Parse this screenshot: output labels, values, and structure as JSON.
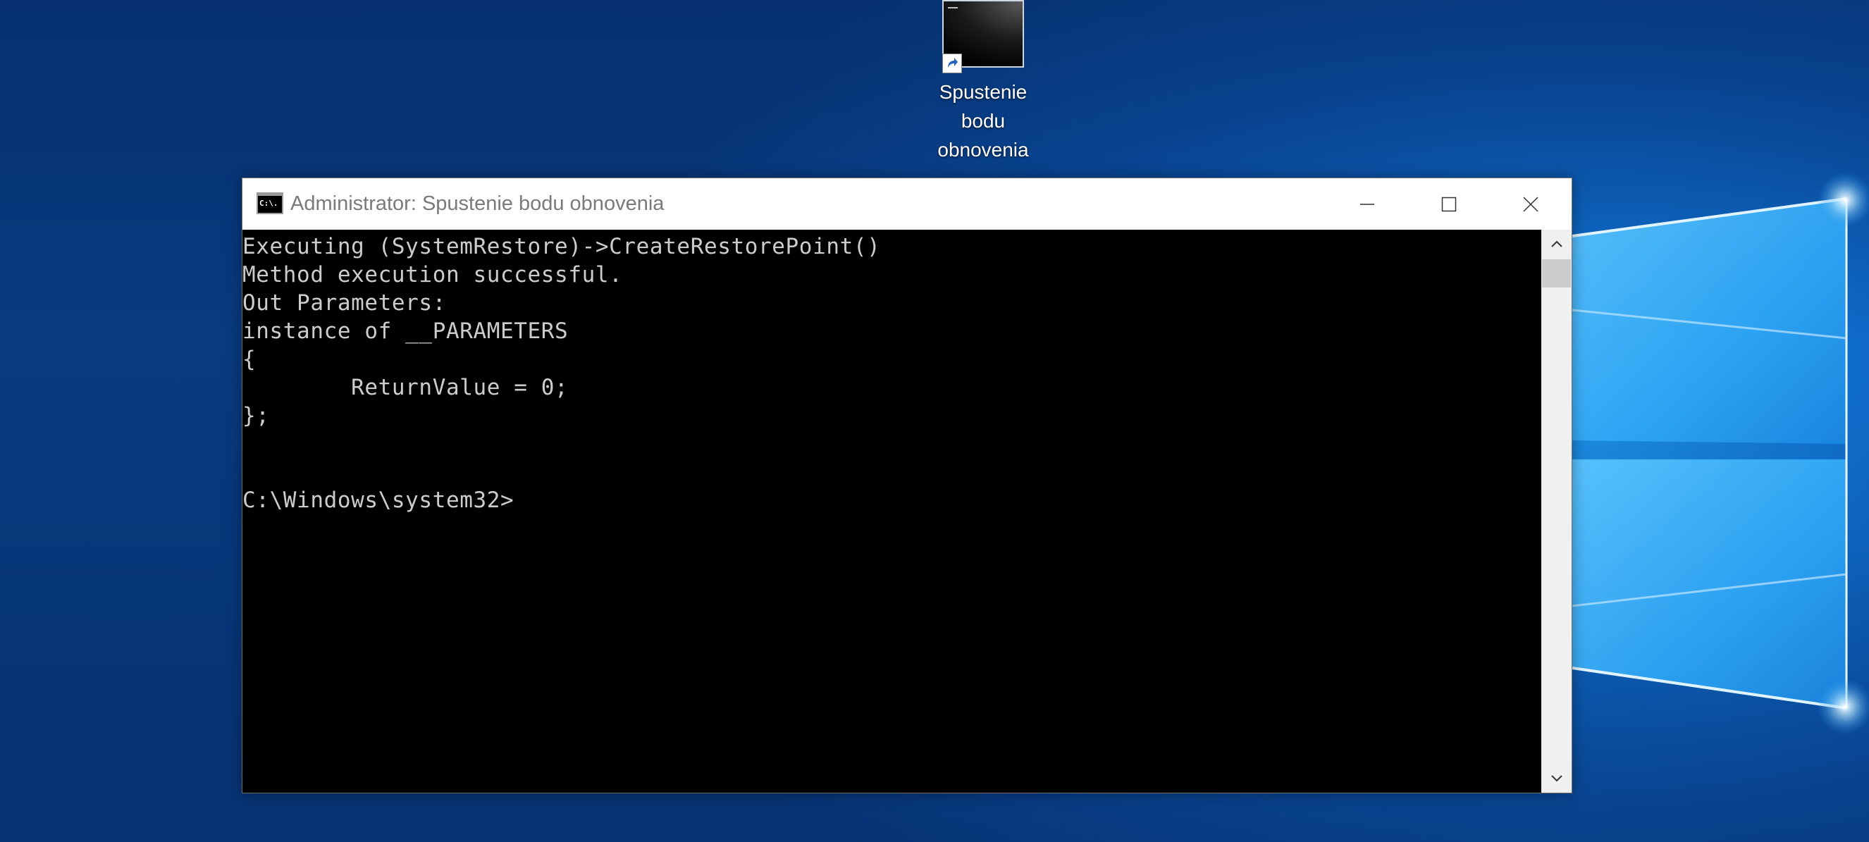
{
  "desktop": {
    "shortcut": {
      "label_line1": "Spustenie",
      "label_line2": "bodu",
      "label_line3": "obnovenia",
      "icon": "console-shortcut-icon"
    }
  },
  "window": {
    "title": "Administrator: Spustenie bodu obnovenia",
    "title_icon_text": "C:\\.",
    "buttons": {
      "minimize": "minimize-icon",
      "maximize": "maximize-icon",
      "close": "close-icon"
    }
  },
  "console": {
    "lines": [
      "Executing (SystemRestore)->CreateRestorePoint()",
      "Method execution successful.",
      "Out Parameters:",
      "instance of __PARAMETERS",
      "{",
      "        ReturnValue = 0;",
      "};",
      "",
      "",
      "C:\\Windows\\system32>"
    ]
  },
  "colors": {
    "console_bg": "#000000",
    "console_fg": "#cccccc",
    "desktop_accent": "#1c8fe6"
  }
}
